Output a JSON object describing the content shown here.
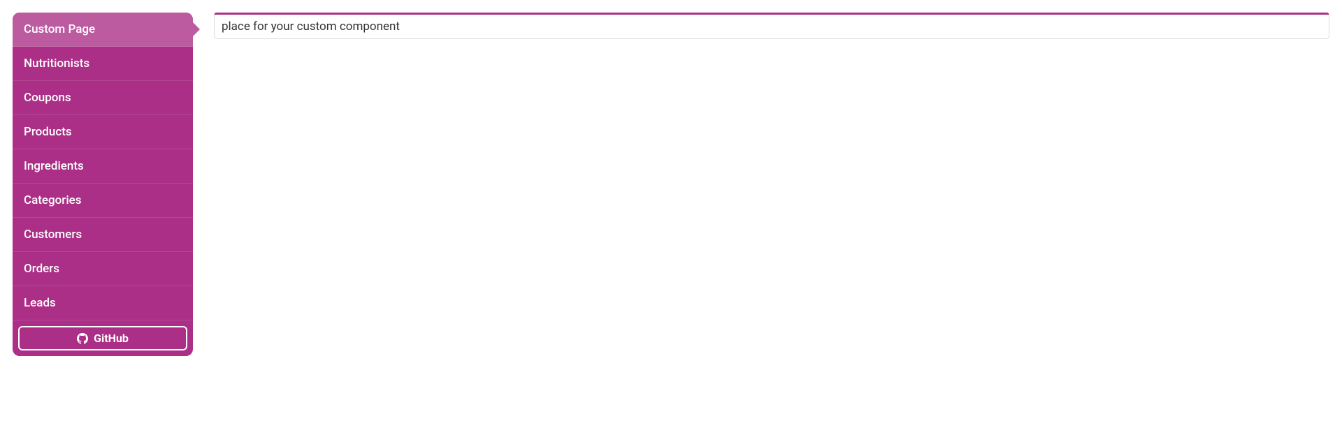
{
  "sidebar": {
    "items": [
      {
        "label": "Custom Page",
        "active": true
      },
      {
        "label": "Nutritionists",
        "active": false
      },
      {
        "label": "Coupons",
        "active": false
      },
      {
        "label": "Products",
        "active": false
      },
      {
        "label": "Ingredients",
        "active": false
      },
      {
        "label": "Categories",
        "active": false
      },
      {
        "label": "Customers",
        "active": false
      },
      {
        "label": "Orders",
        "active": false
      },
      {
        "label": "Leads",
        "active": false
      }
    ],
    "github": {
      "label": "GitHub"
    }
  },
  "main": {
    "content_text": "place for your custom component"
  },
  "colors": {
    "accent": "#ab2f86",
    "accent_light": "#bc5ba0"
  }
}
